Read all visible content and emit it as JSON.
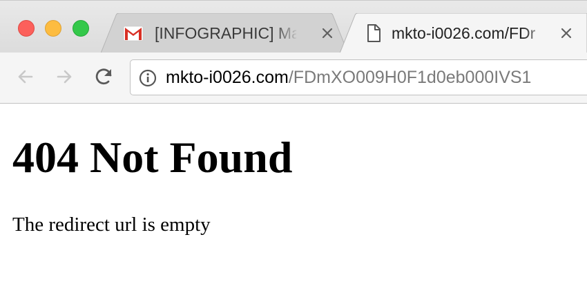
{
  "window": {
    "traffic_lights": {
      "close_color": "#fc605b",
      "minimize_color": "#fdbc40",
      "zoom_color": "#34c84a"
    }
  },
  "tabs": [
    {
      "title": "[INFOGRAPHIC] Mak",
      "icon": "gmail-icon",
      "active": false,
      "close_icon": "close-icon"
    },
    {
      "title": "mkto-i0026.com/FDr",
      "icon": "page-icon",
      "active": true,
      "close_icon": "close-icon"
    }
  ],
  "toolbar": {
    "back_icon": "back-arrow-icon",
    "forward_icon": "forward-arrow-icon",
    "reload_icon": "reload-icon"
  },
  "omnibox": {
    "info_icon": "info-icon",
    "url_host": "mkto-i0026.com",
    "url_path": "/FDmXO009H0F1d0eb000IVS1"
  },
  "page": {
    "heading": "404 Not Found",
    "message": "The redirect url is empty"
  }
}
